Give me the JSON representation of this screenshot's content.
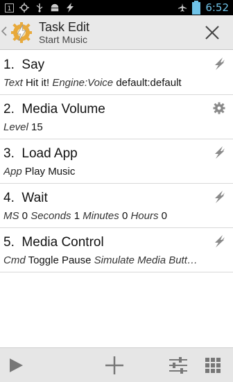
{
  "status_bar": {
    "time": "6:52",
    "battery_level": "62",
    "left_icons": [
      "notification-count-icon",
      "gps-icon",
      "usb-icon",
      "android-debug-icon",
      "bolt-icon"
    ],
    "right_icons": [
      "airplane-mode-icon",
      "battery-icon"
    ]
  },
  "header": {
    "title": "Task Edit",
    "subtitle": "Start Music"
  },
  "actions": [
    {
      "number": "1.",
      "name": "Say",
      "icon": "bolt-icon",
      "params": [
        {
          "key": "Text",
          "value": "Hit it!"
        },
        {
          "key": "Engine:Voice",
          "value": "default:default"
        }
      ]
    },
    {
      "number": "2.",
      "name": "Media Volume",
      "icon": "gear-icon",
      "params": [
        {
          "key": "Level",
          "value": "15"
        }
      ]
    },
    {
      "number": "3.",
      "name": "Load App",
      "icon": "bolt-icon",
      "params": [
        {
          "key": "App",
          "value": "Play Music"
        }
      ]
    },
    {
      "number": "4.",
      "name": "Wait",
      "icon": "bolt-icon",
      "params": [
        {
          "key": "MS",
          "value": "0"
        },
        {
          "key": "Seconds",
          "value": "1"
        },
        {
          "key": "Minutes",
          "value": "0"
        },
        {
          "key": "Hours",
          "value": "0"
        }
      ]
    },
    {
      "number": "5.",
      "name": "Media Control",
      "icon": "bolt-icon",
      "params": [
        {
          "key": "Cmd",
          "value": "Toggle Pause"
        },
        {
          "key": "Simulate Media Butt…",
          "value": ""
        }
      ]
    }
  ],
  "bottom_bar": {
    "buttons": [
      "play-icon",
      "add-icon",
      "settings-sliders-icon",
      "grid-icon"
    ]
  },
  "colors": {
    "status_time": "#6fc3e8",
    "actionbar_bg": "#e9e9e9",
    "bottombar_bg": "#e6e6e6"
  }
}
